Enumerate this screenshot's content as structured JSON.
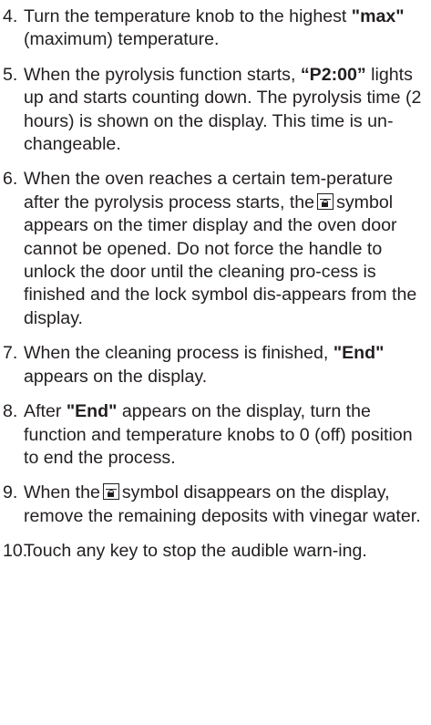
{
  "steps": [
    {
      "num": "4.",
      "parts": [
        "Turn the temperature knob to the highest ",
        "\"max\"",
        " (maximum) temperature."
      ]
    },
    {
      "num": "5.",
      "parts": [
        "When the pyrolysis function starts, ",
        "“P2:00”",
        " lights up and starts counting down. The pyrolysis time (2 hours) is shown on the display. This time is un-changeable."
      ]
    },
    {
      "num": "6.",
      "parts": [
        "When the oven reaches a certain tem-perature after the pyrolysis process starts, the",
        "symbol appears on the timer display and the oven door cannot be opened. Do not force the handle to unlock the door until the cleaning pro-cess is finished and the lock symbol dis-appears from the display."
      ]
    },
    {
      "num": "7.",
      "parts": [
        "When the cleaning process is finished, ",
        "\"End\"",
        " appears on the display."
      ]
    },
    {
      "num": "8.",
      "parts": [
        "After ",
        "\"End\"",
        " appears on the display, turn the function and temperature knobs to 0 (off) position to end the process."
      ]
    },
    {
      "num": "9.",
      "parts": [
        "When the",
        "symbol disappears on the display, remove the remaining deposits with vinegar water."
      ]
    },
    {
      "num": "10.",
      "parts": [
        "Touch any key to stop the audible warn-ing."
      ]
    }
  ],
  "icons": {
    "lock": "lock-icon"
  }
}
